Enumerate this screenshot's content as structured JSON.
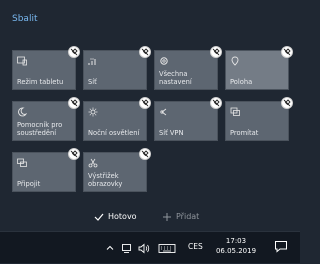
{
  "panel": {
    "collapse_label": "Sbalit",
    "tiles": [
      {
        "label": "Režim tabletu",
        "icon": "tablet-mode-icon"
      },
      {
        "label": "Síť",
        "icon": "network-icon"
      },
      {
        "label": "Všechna nastavení",
        "icon": "settings-gear-icon"
      },
      {
        "label": "Poloha",
        "icon": "location-icon"
      },
      {
        "label": "Pomocník pro soustředění",
        "icon": "focus-assist-moon-icon"
      },
      {
        "label": "Noční osvětlení",
        "icon": "night-light-sun-icon"
      },
      {
        "label": "Síť VPN",
        "icon": "vpn-icon"
      },
      {
        "label": "Promítat",
        "icon": "project-icon"
      },
      {
        "label": "Připojit",
        "icon": "connect-icon"
      },
      {
        "label": "Výstřižek obrazovky",
        "icon": "screen-snip-icon"
      }
    ],
    "done_label": "Hotovo",
    "add_label": "Přidat"
  },
  "taskbar": {
    "language": "CES",
    "time": "17:03",
    "date": "06.05.2019"
  },
  "colors": {
    "accent_link": "#79b8f0",
    "tile_bg": "#5d6671",
    "panel_bg": "#1f2732",
    "taskbar_bg": "#121821"
  }
}
